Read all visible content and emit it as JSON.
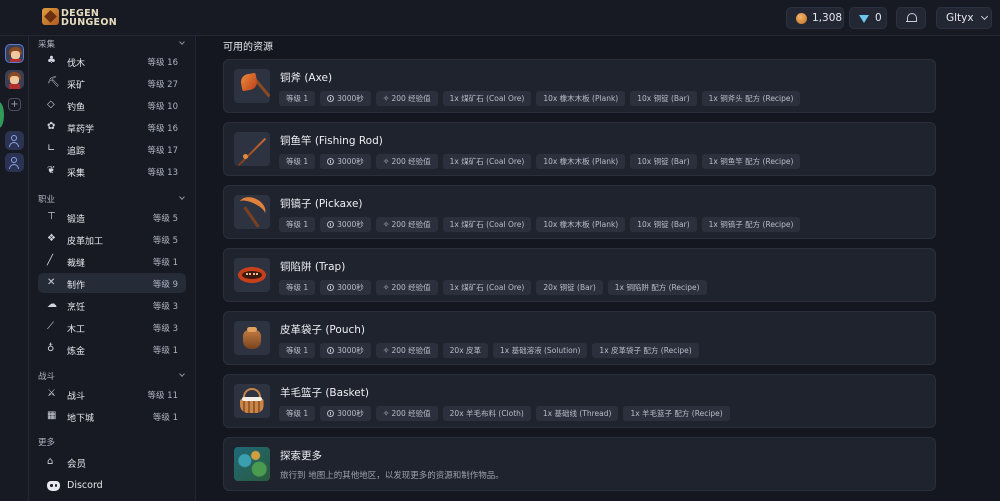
{
  "app": {
    "logo_line1": "DEGEN",
    "logo_line2": "DUNGEON"
  },
  "header": {
    "coins": "1,308",
    "gems": "0",
    "user": "Gltyx",
    "colors": {
      "coin": "#d07a30",
      "gem": "#6ec6f0",
      "accent": "#5a78d8"
    }
  },
  "rail": {
    "add_label": "+",
    "icons": [
      "avatar-1",
      "avatar-2",
      "add-icon",
      "users-icon",
      "user-add-icon"
    ]
  },
  "sidebar": {
    "sections": [
      {
        "title": "采集",
        "items": [
          {
            "name": "伐木",
            "level": "等级 16",
            "icon": "tree-icon"
          },
          {
            "name": "采矿",
            "level": "等级 27",
            "icon": "pickaxe-icon"
          },
          {
            "name": "钓鱼",
            "level": "等级 10",
            "icon": "fish-icon"
          },
          {
            "name": "草药学",
            "level": "等级 16",
            "icon": "herb-icon"
          },
          {
            "name": "追踪",
            "level": "等级 17",
            "icon": "boot-icon"
          },
          {
            "name": "采集",
            "level": "等级 13",
            "icon": "leaf-icon"
          }
        ]
      },
      {
        "title": "职业",
        "items": [
          {
            "name": "锻造",
            "level": "等级 5",
            "icon": "anvil-icon"
          },
          {
            "name": "皮革加工",
            "level": "等级 5",
            "icon": "hide-icon"
          },
          {
            "name": "裁缝",
            "level": "等级 1",
            "icon": "needle-icon"
          },
          {
            "name": "制作",
            "level": "等级 9",
            "icon": "crossed-tools-icon"
          },
          {
            "name": "烹饪",
            "level": "等级 3",
            "icon": "chef-hat-icon"
          },
          {
            "name": "木工",
            "level": "等级 3",
            "icon": "saw-icon"
          },
          {
            "name": "炼金",
            "level": "等级 1",
            "icon": "potion-icon"
          }
        ]
      },
      {
        "title": "战斗",
        "items": [
          {
            "name": "战斗",
            "level": "等级 11",
            "icon": "sword-icon"
          },
          {
            "name": "地下城",
            "level": "等级 1",
            "icon": "dungeon-icon"
          }
        ]
      },
      {
        "title": "更多",
        "items": [
          {
            "name": "会员",
            "level": "",
            "icon": "temple-icon"
          },
          {
            "name": "Discord",
            "level": "",
            "icon": "discord-icon"
          }
        ]
      }
    ]
  },
  "main": {
    "title": "可用的资源",
    "cards": [
      {
        "title": "铜斧 (Axe)",
        "chips": [
          "等级 1",
          "3000秒",
          "200 经验值",
          "1x 煤矿石 (Coal Ore)",
          "10x 橡木木板 (Plank)",
          "10x 铜锭 (Bar)",
          "1x 铜斧头 配方 (Recipe)"
        ]
      },
      {
        "title": "铜鱼竿 (Fishing Rod)",
        "chips": [
          "等级 1",
          "3000秒",
          "200 经验值",
          "1x 煤矿石 (Coal Ore)",
          "10x 橡木木板 (Plank)",
          "10x 铜锭 (Bar)",
          "1x 铜鱼竿 配方 (Recipe)"
        ]
      },
      {
        "title": "铜镐子 (Pickaxe)",
        "chips": [
          "等级 1",
          "3000秒",
          "200 经验值",
          "1x 煤矿石 (Coal Ore)",
          "10x 橡木木板 (Plank)",
          "10x 铜锭 (Bar)",
          "1x 铜镐子 配方 (Recipe)"
        ]
      },
      {
        "title": "铜陷阱 (Trap)",
        "chips": [
          "等级 1",
          "3000秒",
          "200 经验值",
          "1x 煤矿石 (Coal Ore)",
          "20x 铜锭 (Bar)",
          "1x 铜陷阱 配方 (Recipe)"
        ]
      },
      {
        "title": "皮革袋子 (Pouch)",
        "chips": [
          "等级 1",
          "3000秒",
          "200 经验值",
          "20x 皮革",
          "1x 基础溶液 (Solution)",
          "1x 皮革袋子 配方 (Recipe)"
        ]
      },
      {
        "title": "羊毛篮子 (Basket)",
        "chips": [
          "等级 1",
          "3000秒",
          "200 经验值",
          "20x 羊毛布料 (Cloth)",
          "1x 基础线 (Thread)",
          "1x 羊毛篮子 配方 (Recipe)"
        ]
      }
    ],
    "explore": {
      "title": "探索更多",
      "subtitle": "旅行到 地图上的其他地区，以发现更多的资源和制作物品。"
    }
  }
}
